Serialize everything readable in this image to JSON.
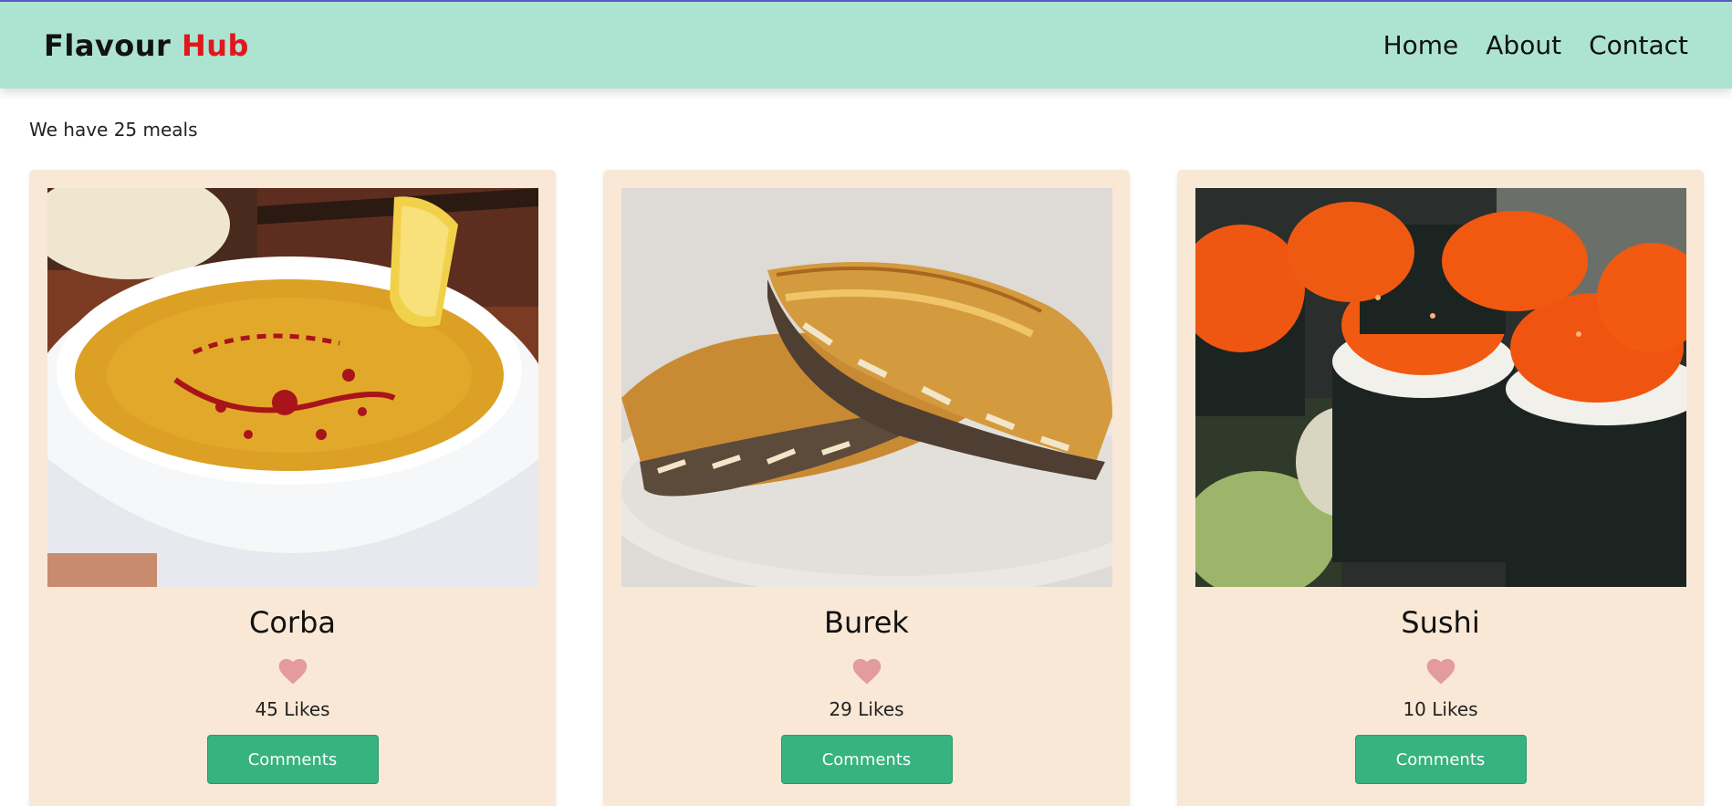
{
  "header": {
    "logo_part1": "Flavour",
    "logo_part2": "Hub",
    "nav": [
      {
        "label": "Home"
      },
      {
        "label": "About"
      },
      {
        "label": "Contact"
      }
    ]
  },
  "summary": "We have 25 meals",
  "meals": [
    {
      "name": "Corba",
      "likes": "45 Likes",
      "button": "Comments",
      "image": "lentil soup in white bowl with lemon"
    },
    {
      "name": "Burek",
      "likes": "29 Likes",
      "button": "Comments",
      "image": "meat filled pastry on plate"
    },
    {
      "name": "Sushi",
      "likes": "10 Likes",
      "button": "Comments",
      "image": "sushi rolls with orange roe"
    }
  ],
  "colors": {
    "header_bg": "#ade4d1",
    "card_bg": "#f9e8d6",
    "button_bg": "#36b37e",
    "logo_accent": "#e0171c",
    "heart": "#e39b9b"
  }
}
